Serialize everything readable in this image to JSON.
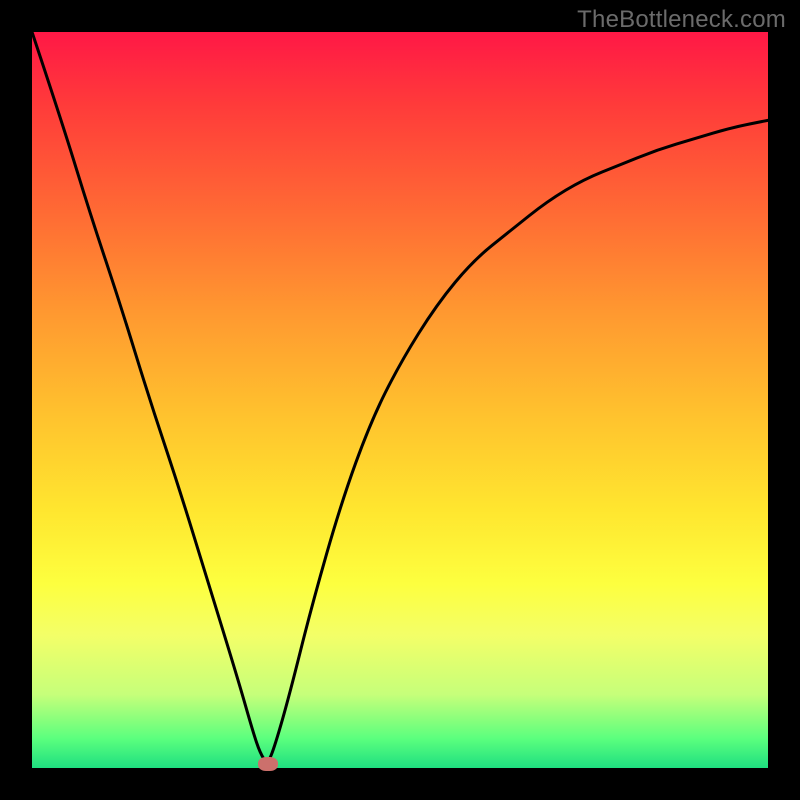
{
  "watermark": "TheBottleneck.com",
  "colors": {
    "frame": "#000000",
    "curve": "#000000",
    "marker": "#cc706c"
  },
  "chart_data": {
    "type": "line",
    "title": "",
    "xlabel": "",
    "ylabel": "",
    "xlim": [
      0,
      100
    ],
    "ylim": [
      0,
      100
    ],
    "grid": false,
    "series": [
      {
        "name": "bottleneck-curve",
        "x": [
          0,
          4,
          8,
          12,
          16,
          20,
          24,
          28,
          30,
          31,
          32,
          33,
          35,
          38,
          42,
          46,
          50,
          55,
          60,
          65,
          70,
          75,
          80,
          85,
          90,
          95,
          100
        ],
        "y": [
          100,
          88,
          75,
          63,
          50,
          38,
          25,
          12,
          5,
          2,
          0.5,
          3,
          10,
          22,
          36,
          47,
          55,
          63,
          69,
          73,
          77,
          80,
          82,
          84,
          85.5,
          87,
          88
        ]
      }
    ],
    "marker": {
      "x": 32,
      "y": 0.5
    }
  }
}
